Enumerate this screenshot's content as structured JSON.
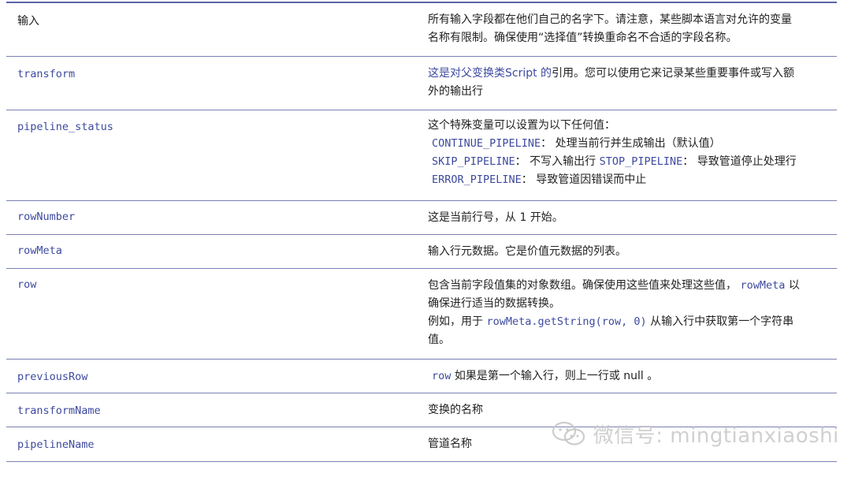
{
  "rows": [
    {
      "name": "输入",
      "desc": [
        "所有输入字段都在他们自己的名字下。请注意，某些脚本语言对允许的变量",
        "名称有限制。确保使用“选择值”转换重命名不合适的字段名称。"
      ]
    },
    {
      "name": "transform",
      "desc_link": "这是对父变换类Script 的",
      "desc_rest": "引用。您可以使用它来记录某些重要事件或写入额",
      "desc2": "外的输出行"
    },
    {
      "name": "pipeline_status",
      "intro": "这个特殊变量可以设置为以下任何值：",
      "c1": "CONTINUE_PIPELINE",
      "c1_text": "： 处理当前行并生成输出（默认值）",
      "c2": "SKIP_PIPELINE",
      "c2_text": "： 不写入输出行 ",
      "c3": "STOP_PIPELINE",
      "c3_text": "： 导致管道停止处理行",
      "c4": "ERROR_PIPELINE",
      "c4_text": "： 导致管道因错误而中止"
    },
    {
      "name": "rowNumber",
      "desc": "这是当前行号，从 1 开始。"
    },
    {
      "name": "rowMeta",
      "desc": "输入行元数据。它是价值元数据的列表。"
    },
    {
      "name": "row",
      "l1a": "包含当前字段值集的对象数组。确保使用这些值来处理这些值，",
      "l1code": "rowMeta",
      "l1b": "以",
      "l2": "确保进行适当的数据转换。",
      "l3a": "例如，用于",
      "l3code": "rowMeta.getString(row, 0)",
      "l3b": "从输入行中获取第一个字符串",
      "l4": "值。"
    },
    {
      "name": "previousRow",
      "code": "row",
      "desc": "如果是第一个输入行，则上一行或 null 。"
    },
    {
      "name": "transformName",
      "desc": "变换的名称"
    },
    {
      "name": "pipelineName",
      "desc": "管道名称"
    }
  ],
  "watermark": "微信号: mingtianxiaoshi"
}
